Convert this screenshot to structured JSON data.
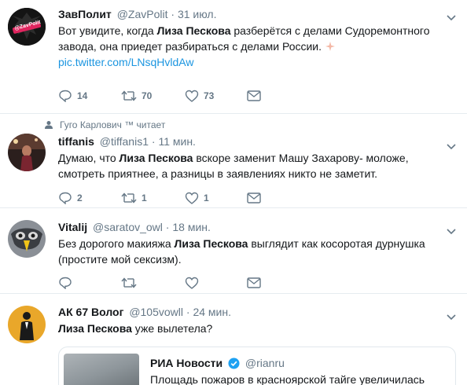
{
  "tweets": [
    {
      "name": "ЗавПолит",
      "handle": "@ZavPolit",
      "dot": "·",
      "time": "31 июл.",
      "avatar_label": "@ZavPolit",
      "text_a": "Вот увидите, когда ",
      "text_bold": "Лиза Пескова",
      "text_b": " разберётся с делами Судоремонтного завода, она приедет разбираться с делами России.",
      "link": "pic.twitter.com/LNsqHvldAw",
      "replies": "14",
      "retweets": "70",
      "likes": "73"
    },
    {
      "context": "Гуго Карлович ™ читает",
      "name": "tiffanis",
      "handle": "@tiffanis1",
      "dot": "·",
      "time": "11 мин.",
      "text_a": "Думаю, что ",
      "text_bold": "Лиза Пескова",
      "text_b": " вскоре заменит Машу Захарову- моложе, смотреть приятнее, а разницы в заявлениях никто не заметит.",
      "replies": "2",
      "retweets": "1",
      "likes": "1"
    },
    {
      "name": "Vitalij",
      "handle": "@saratov_owl",
      "dot": "·",
      "time": "18 мин.",
      "text_a": "Без дорогого макияжа ",
      "text_bold": "Лиза Пескова",
      "text_b": " выглядит как косоротая дурнушка (простите мой сексизм).",
      "replies": "",
      "retweets": "",
      "likes": ""
    },
    {
      "name": "АК 67 Волог",
      "handle": "@105vowll",
      "dot": "·",
      "time": "24 мин.",
      "text_bold": "Лиза Пескова",
      "text_b": " уже вылетела?",
      "quote": {
        "name": "РИА Новости",
        "handle": "@rianru",
        "text": "Площадь пожаров в красноярской тайге увеличилась"
      }
    }
  ],
  "colors": {
    "link": "#1b95e0",
    "secondary_text": "#657786",
    "divider": "#e6ecf0",
    "verified": "#1da1f2"
  },
  "icons": [
    "reply-icon",
    "retweet-icon",
    "like-icon",
    "message-icon",
    "chevron-down-icon",
    "verified-icon",
    "retweet-context-icon"
  ]
}
